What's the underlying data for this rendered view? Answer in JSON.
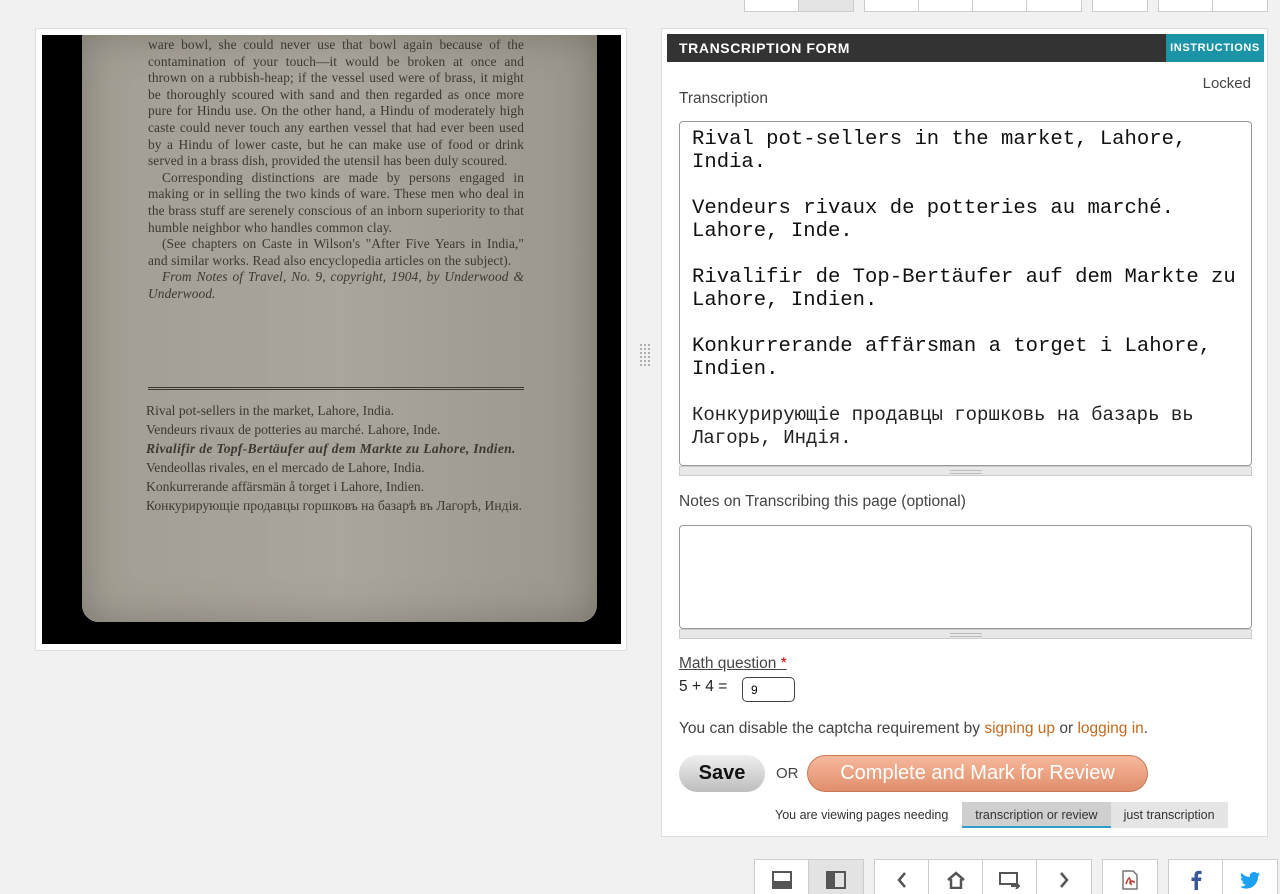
{
  "viewer": {
    "page_body": [
      "ware bowl, she could never use that bowl again because of the contamination of your touch—it would be broken at once and thrown on a rubbish-heap; if the vessel used were of brass, it might be thoroughly scoured with sand and then regarded as once more pure for Hindu use. On the other hand, a Hindu of moderately high caste could never touch any earthen vessel that had ever been used by a Hindu of lower caste, but he can make use of food or drink served in a brass dish, provided the utensil has been duly scoured.",
      "Corresponding distinctions are made by persons engaged in making or in selling the two kinds of ware. These men who deal in the brass stuff are serenely conscious of an inborn superiority to that humble neighbor who handles common clay.",
      "(See chapters on Caste in Wilson's \"After Five Years in India,\" and similar works. Read also encyclopedia articles on the subject)."
    ],
    "page_credit": "From Notes of Travel, No. 9, copyright, 1904, by Underwood & Underwood.",
    "page_captions": [
      "Rival pot-sellers in the market, Lahore, India.",
      "Vendeurs rivaux de potteries au marché. Lahore, Inde.",
      "Rivalifir de Topf-Bertäufer auf dem Markte zu Lahore, Indien.",
      "Vendeollas rivales, en el mercado de Lahore, India.",
      "Konkurrerande affärsmän å torget i Lahore, Indien.",
      "Конкурирующіе продавцы горшковъ на базарѣ въ Лагорѣ, Индія."
    ]
  },
  "form": {
    "title": "TRANSCRIPTION FORM",
    "instructions_label": "INSTRUCTIONS",
    "lock_status": "Locked",
    "transcription_label": "Transcription",
    "transcription_lines": [
      "Rival pot-sellers in the market, Lahore, India.",
      "Vendeurs rivaux de potteries au marché. Lahore, Inde.",
      "Rivalifir de Top-Bertäufer auf dem Markte zu Lahore, Indien.",
      "Konkurrerande affärsman a torget i Lahore, Indien.",
      "Конкурирующіе продавцы горшковь на базарь вь Лагорь, Индія."
    ],
    "notes_label": "Notes on Transcribing this page (optional)",
    "notes_value": "",
    "math_label": "Math question",
    "math_required_mark": "*",
    "math_question": "5 + 4 =",
    "math_answer": "9",
    "captcha_text_before": "You can disable the captcha requirement by",
    "signup_link": "signing up",
    "captcha_or": "or",
    "login_link": "logging in",
    "captcha_period": ".",
    "save_label": "Save",
    "or_label": "OR",
    "review_label": "Complete and Mark for Review",
    "viewing_text": "You are viewing pages needing",
    "filter_options": [
      "transcription or review",
      "just transcription"
    ],
    "filter_selected": "transcription or review"
  },
  "toolbar_bottom": {
    "icons": [
      "layout-horizontal-icon",
      "layout-vertical-icon",
      "previous-icon",
      "home-icon",
      "random-page-icon",
      "next-icon",
      "pdf-icon",
      "facebook-icon",
      "twitter-icon"
    ],
    "selected": "layout-vertical-icon"
  },
  "colors": {
    "header_bg": "#333333",
    "instructions_bg": "#1b94a8",
    "link": "#c26a1e",
    "review_button": "#e08e6b",
    "filter_underline": "#2b9ec9"
  }
}
